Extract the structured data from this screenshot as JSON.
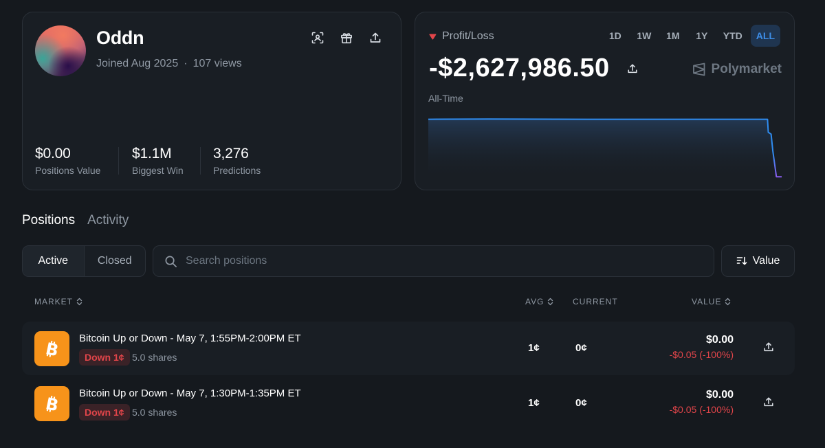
{
  "profile": {
    "username": "Oddn",
    "joined": "Joined Aug 2025",
    "separator": "·",
    "views": "107 views",
    "stats": [
      {
        "value": "$0.00",
        "label": "Positions Value"
      },
      {
        "value": "$1.1M",
        "label": "Biggest Win"
      },
      {
        "value": "3,276",
        "label": "Predictions"
      }
    ],
    "icons": [
      "scan-icon",
      "gift-icon",
      "share-icon"
    ]
  },
  "pnl": {
    "title": "Profit/Loss",
    "value": "-$2,627,986.50",
    "period": "All-Time",
    "brand": "Polymarket",
    "ranges": [
      "1D",
      "1W",
      "1M",
      "1Y",
      "YTD",
      "ALL"
    ],
    "active_range": "ALL",
    "colors": {
      "line": "#2f8cf0",
      "drop": "#8a5cf0",
      "down_indicator": "#e2454a"
    },
    "chart_data": {
      "type": "line",
      "x_fraction": [
        0,
        0.17,
        0.45,
        0.7,
        0.96,
        0.962,
        0.97,
        0.975,
        0.985,
        1
      ],
      "y_level": [
        0.96,
        0.965,
        0.96,
        0.96,
        0.96,
        0.75,
        0.72,
        0.45,
        0.03,
        0.03
      ]
    }
  },
  "tabs": [
    {
      "label": "Positions",
      "active": true
    },
    {
      "label": "Activity",
      "active": false
    }
  ],
  "filters": {
    "active_label": "Active",
    "closed_label": "Closed",
    "search_placeholder": "Search positions",
    "sort_label": "Value"
  },
  "table": {
    "headers": {
      "market": "MARKET",
      "avg": "AVG",
      "current": "CURRENT",
      "value": "VALUE"
    },
    "rows": [
      {
        "title": "Bitcoin Up or Down - May 7, 1:55PM-2:00PM ET",
        "outcome": "Down 1¢",
        "shares": "5.0 shares",
        "avg": "1¢",
        "current": "0¢",
        "value": "$0.00",
        "change": "-$0.05 (-100%)"
      },
      {
        "title": "Bitcoin Up or Down - May 7, 1:30PM-1:35PM ET",
        "outcome": "Down 1¢",
        "shares": "5.0 shares",
        "avg": "1¢",
        "current": "0¢",
        "value": "$0.00",
        "change": "-$0.05 (-100%)"
      }
    ]
  }
}
